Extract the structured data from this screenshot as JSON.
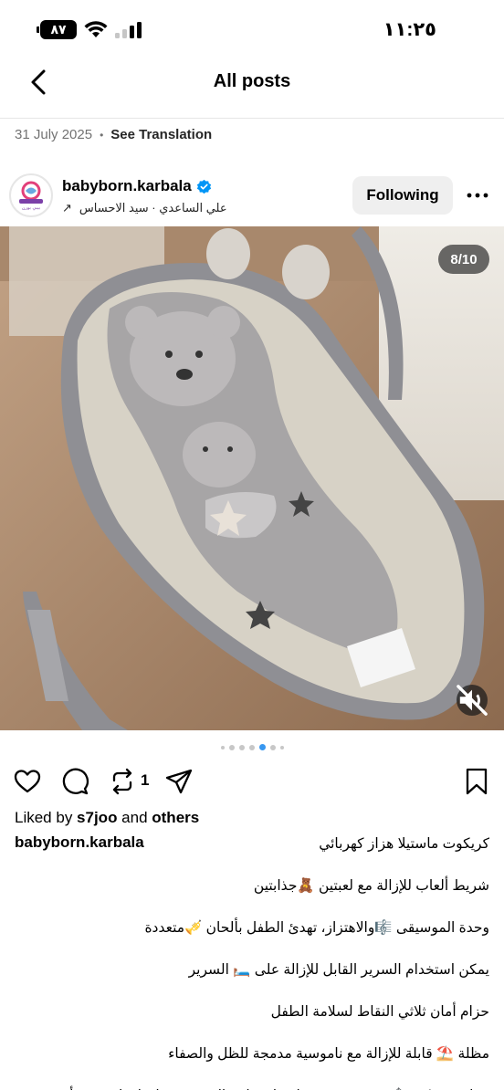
{
  "status_bar": {
    "time": "١١:٢٥",
    "battery": "٨٧"
  },
  "nav": {
    "title": "All posts"
  },
  "meta": {
    "date": "31 July 2025",
    "separator": "•",
    "see_translation": "See Translation"
  },
  "post": {
    "username": "babyborn.karbala",
    "audio": "علي الساعدي · سيد الاحساس",
    "audio_arrow": "↗",
    "follow_label": "Following",
    "avatar_text": "بيبي بورن"
  },
  "media": {
    "counter": "8/10",
    "dots_total": 7,
    "dots_active_index": 4
  },
  "actions": {
    "repost_count": "1"
  },
  "likes": {
    "prefix": "Liked by ",
    "user": "s7joo",
    "middle": " and ",
    "others": "others"
  },
  "caption": {
    "username": "babyborn.karbala",
    "lines": [
      "كريكوت ماستيلا هزاز كهربائي",
      "شريط ألعاب للإزالة مع لعبتين 🧸جذابتين",
      "وحدة الموسيقى 🎼والاهتزاز، تهدئ الطفل بألحان 🎺متعددة",
      "يمكن استخدام السرير القابل للإزالة على 🛏️ السرير",
      "حزام أمان ثلاثي النقاط لسلامة الطفل",
      "مظلة ⛱️ قابلة للإزالة مع ناموسية مدمجة للظل والصفاء",
      "جوانب شبكية 🕸️ فريدة من نوعها تبطئ راحة التنفس وتحافظ على رؤية أم"
    ]
  },
  "colors": {
    "verified": "#0095f6",
    "active_dot": "#3797f0",
    "muted_text": "#737373",
    "button_bg": "#efefef"
  }
}
